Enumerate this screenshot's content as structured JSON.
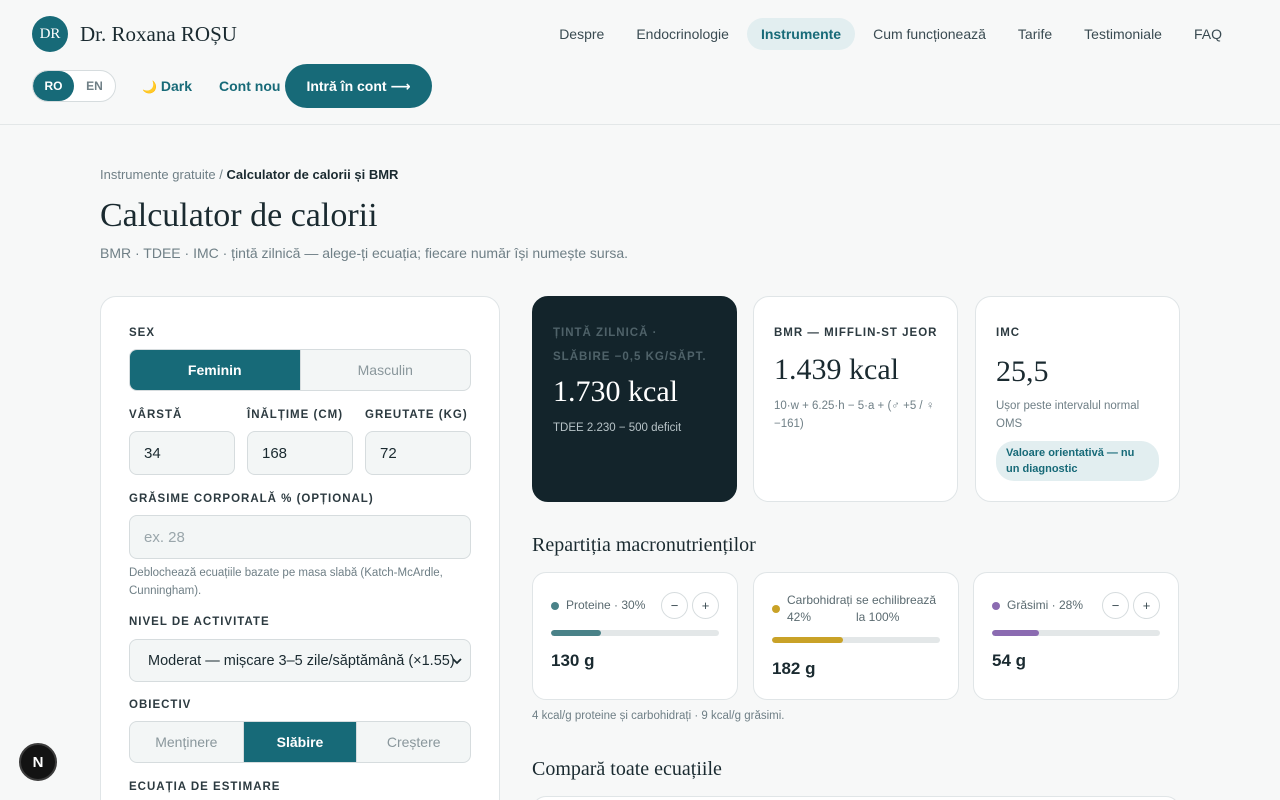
{
  "brand": {
    "initials": "DR",
    "name": "Dr. Roxana ROȘU"
  },
  "nav": {
    "items": [
      {
        "label": "Despre",
        "active": false
      },
      {
        "label": "Endocrinologie",
        "active": false
      },
      {
        "label": "Instrumente",
        "active": true
      },
      {
        "label": "Cum funcționează",
        "active": false
      },
      {
        "label": "Tarife",
        "active": false
      },
      {
        "label": "Testimoniale",
        "active": false
      },
      {
        "label": "FAQ",
        "active": false
      }
    ]
  },
  "header": {
    "lang_ro": "RO",
    "lang_en": "EN",
    "lang_selected": "RO",
    "dark_icon": "🌙",
    "dark_label": "Dark",
    "signup_label": "Cont nou",
    "login_label": "Intră în cont ⟶"
  },
  "breadcrumb": {
    "parent": "Instrumente gratuite",
    "separator": "/",
    "current": "Calculator de calorii și BMR"
  },
  "page": {
    "title": "Calculator de calorii",
    "subtitle": "BMR · TDEE · IMC · țintă zilnică — alege-ți ecuația; fiecare număr își numește sursa."
  },
  "form": {
    "sex_label": "SEX",
    "sex_options": [
      "Feminin",
      "Masculin"
    ],
    "sex_selected": "Feminin",
    "age_label": "VÂRSTĂ",
    "age_value": "34",
    "height_label": "ÎNĂLȚIME (CM)",
    "height_value": "168",
    "weight_label": "GREUTATE (KG)",
    "weight_value": "72",
    "bodyfat_label": "GRĂSIME CORPORALĂ % (OPȚIONAL)",
    "bodyfat_placeholder": "ex. 28",
    "bodyfat_hint": "Deblochează ecuațiile bazate pe masa slabă (Katch-McArdle, Cunningham).",
    "activity_label": "NIVEL DE ACTIVITATE",
    "activity_value": "Moderat — mișcare 3–5 zile/săptămână (×1.55)",
    "goal_label": "OBIECTIV",
    "goal_options": [
      "Menținere",
      "Slăbire",
      "Creștere"
    ],
    "goal_selected": "Slăbire",
    "equation_label": "ECUAȚIA DE ESTIMARE"
  },
  "results": {
    "target": {
      "label": "ȚINTĂ ZILNICĂ · SLĂBIRE −0,5 KG/SĂPT.",
      "value": "1.730 kcal",
      "note": "TDEE 2.230 − 500 deficit"
    },
    "bmr": {
      "label": "BMR — MIFFLIN-ST JEOR",
      "value": "1.439 kcal",
      "note": "10·w + 6.25·h − 5·a + (♂ +5 / ♀ −161)"
    },
    "bmi": {
      "label": "IMC",
      "value": "25,5",
      "note": "Ușor peste intervalul normal OMS",
      "badge": "Valoare orientativă — nu un diagnostic"
    }
  },
  "macros": {
    "title": "Repartiția macronutrienților",
    "items": [
      {
        "name": "Proteine · 30%",
        "grams": "130 g",
        "fraction": 0.3,
        "color": "#4a8288",
        "adjustable": true
      },
      {
        "name": "Carbohidrați · 42%",
        "extra": "se echilibrează la 100%",
        "grams": "182 g",
        "fraction": 0.42,
        "color": "#c9a227",
        "adjustable": false
      },
      {
        "name": "Grăsimi · 28%",
        "grams": "54 g",
        "fraction": 0.28,
        "color": "#8b6bb1",
        "adjustable": true
      }
    ],
    "minus": "−",
    "plus": "+",
    "note": "4 kcal/g proteine și carbohidrați · 9 kcal/g grăsimi."
  },
  "compare": {
    "title": "Compară toate ecuațiile"
  },
  "devtools_badge": "N",
  "colors": {
    "accent": "#176a78",
    "dark_card": "#13242b"
  }
}
